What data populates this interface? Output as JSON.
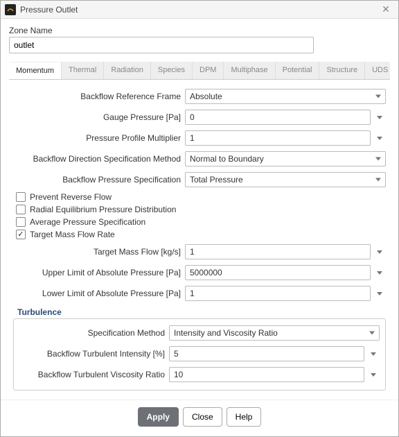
{
  "window": {
    "title": "Pressure Outlet"
  },
  "zone": {
    "label": "Zone Name",
    "value": "outlet"
  },
  "tabs": [
    {
      "label": "Momentum",
      "active": true
    },
    {
      "label": "Thermal"
    },
    {
      "label": "Radiation"
    },
    {
      "label": "Species"
    },
    {
      "label": "DPM"
    },
    {
      "label": "Multiphase"
    },
    {
      "label": "Potential"
    },
    {
      "label": "Structure"
    },
    {
      "label": "UDS"
    }
  ],
  "form": {
    "backflow_ref_frame": {
      "label": "Backflow Reference Frame",
      "value": "Absolute"
    },
    "gauge_pressure": {
      "label": "Gauge Pressure [Pa]",
      "value": "0"
    },
    "profile_multiplier": {
      "label": "Pressure Profile Multiplier",
      "value": "1"
    },
    "dir_spec_method": {
      "label": "Backflow Direction Specification Method",
      "value": "Normal to Boundary"
    },
    "pressure_spec": {
      "label": "Backflow Pressure Specification",
      "value": "Total Pressure"
    }
  },
  "checks": {
    "prevent_reverse": {
      "label": "Prevent Reverse Flow",
      "checked": false
    },
    "radial_eq": {
      "label": "Radial Equilibrium Pressure Distribution",
      "checked": false
    },
    "avg_pressure": {
      "label": "Average Pressure Specification",
      "checked": false
    },
    "target_mfr": {
      "label": "Target Mass Flow Rate",
      "checked": true
    }
  },
  "target": {
    "mass_flow": {
      "label": "Target Mass Flow [kg/s]",
      "value": "1"
    },
    "upper_limit": {
      "label": "Upper Limit of Absolute Pressure [Pa]",
      "value": "5000000"
    },
    "lower_limit": {
      "label": "Lower Limit of Absolute Pressure [Pa]",
      "value": "1"
    }
  },
  "turbulence": {
    "title": "Turbulence",
    "spec_method": {
      "label": "Specification Method",
      "value": "Intensity and Viscosity Ratio"
    },
    "intensity": {
      "label": "Backflow Turbulent Intensity [%]",
      "value": "5"
    },
    "viscosity_ratio": {
      "label": "Backflow Turbulent Viscosity Ratio",
      "value": "10"
    }
  },
  "footer": {
    "apply": "Apply",
    "close": "Close",
    "help": "Help"
  }
}
